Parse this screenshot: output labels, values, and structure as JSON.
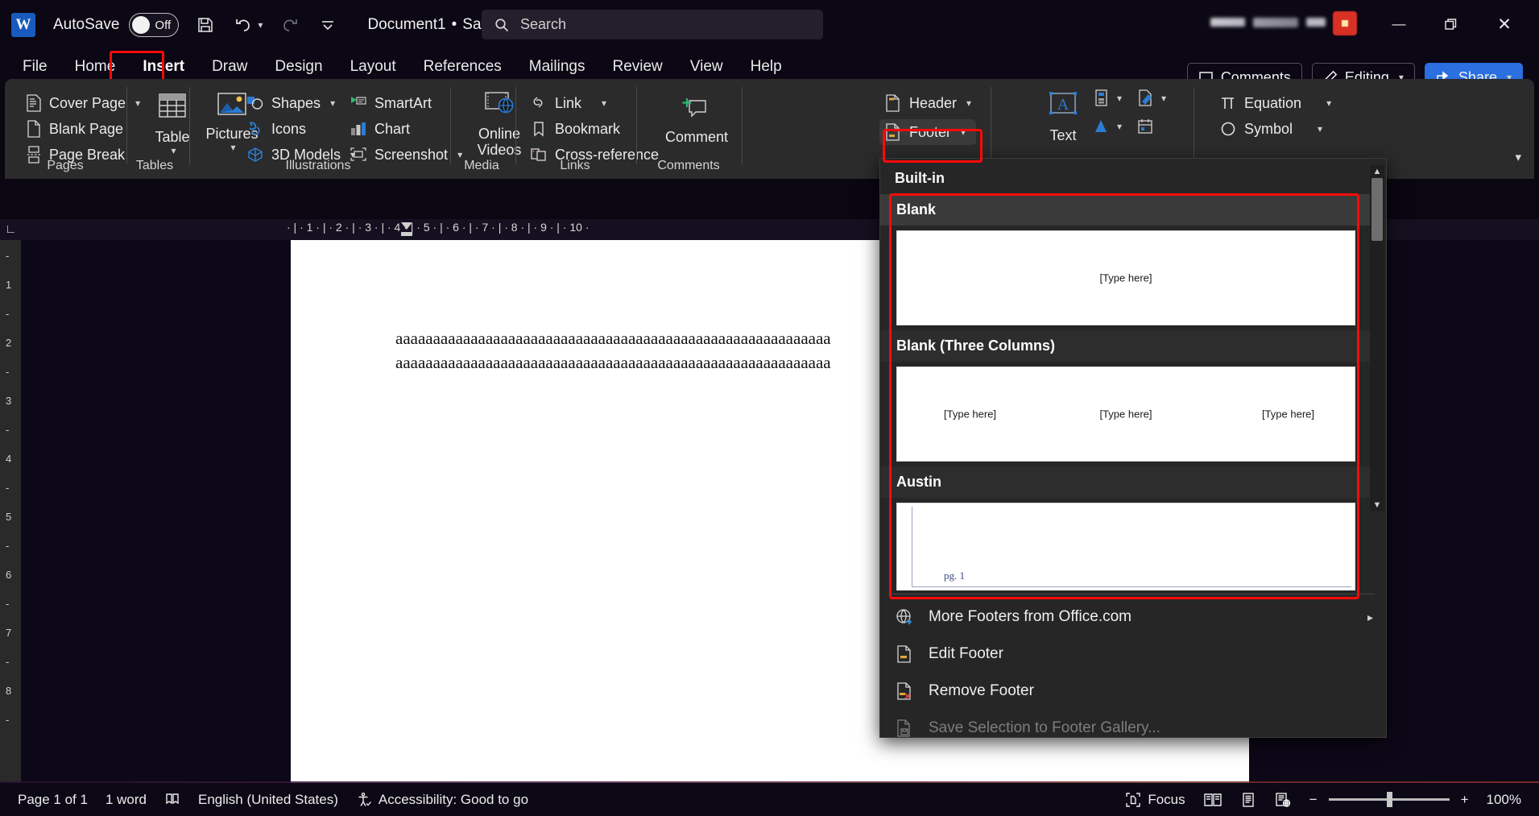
{
  "titlebar": {
    "app_logo": "word-logo",
    "autosave_label": "AutoSave",
    "autosave_state": "Off",
    "save_icon": "save-icon",
    "undo_icon": "undo-icon",
    "redo_icon": "redo-icon",
    "customize_icon": "customize-quick-access-icon",
    "document_title": "Document1",
    "save_state": "Saved",
    "title_chevron": "chevron-down-icon",
    "minimize": "minimize-icon",
    "restore": "restore-icon",
    "close": "close-icon"
  },
  "search": {
    "icon": "search-icon",
    "placeholder": "Search"
  },
  "tabs": [
    {
      "label": "File",
      "active": false
    },
    {
      "label": "Home",
      "active": false
    },
    {
      "label": "Insert",
      "active": true
    },
    {
      "label": "Draw",
      "active": false
    },
    {
      "label": "Design",
      "active": false
    },
    {
      "label": "Layout",
      "active": false
    },
    {
      "label": "References",
      "active": false
    },
    {
      "label": "Mailings",
      "active": false
    },
    {
      "label": "Review",
      "active": false
    },
    {
      "label": "View",
      "active": false
    },
    {
      "label": "Help",
      "active": false
    }
  ],
  "header_buttons": {
    "comments": "Comments",
    "comments_icon": "comment-icon",
    "editing": "Editing",
    "editing_icon": "pencil-icon",
    "editing_chevron": "chevron-down-icon",
    "share": "Share",
    "share_icon": "share-icon",
    "share_chevron": "chevron-down-icon"
  },
  "ribbon": {
    "groups": [
      {
        "name": "Pages",
        "label": "Pages"
      },
      {
        "name": "Tables",
        "label": "Tables"
      },
      {
        "name": "Illustrations",
        "label": "Illustrations"
      },
      {
        "name": "Media",
        "label": "Media"
      },
      {
        "name": "Links",
        "label": "Links"
      },
      {
        "name": "Comments",
        "label": "Comments"
      }
    ],
    "pages": [
      {
        "label": "Cover Page",
        "icon": "cover-page-icon",
        "chevron": true
      },
      {
        "label": "Blank Page",
        "icon": "blank-page-icon",
        "chevron": false
      },
      {
        "label": "Page Break",
        "icon": "page-break-icon",
        "chevron": false
      }
    ],
    "table": {
      "label": "Table",
      "icon": "table-icon",
      "chevron": true
    },
    "pictures": {
      "label": "Pictures",
      "icon": "pictures-icon",
      "chevron": true
    },
    "illustrations": [
      {
        "label": "Shapes",
        "icon": "shapes-icon",
        "chevron": true
      },
      {
        "label": "Icons",
        "icon": "icons-icon",
        "chevron": false
      },
      {
        "label": "3D Models",
        "icon": "3d-models-icon",
        "chevron": true
      },
      {
        "label": "SmartArt",
        "icon": "smartart-icon",
        "chevron": false
      },
      {
        "label": "Chart",
        "icon": "chart-icon",
        "chevron": false
      },
      {
        "label": "Screenshot",
        "icon": "screenshot-icon",
        "chevron": true
      }
    ],
    "online_videos": {
      "label": "Online Videos",
      "icon": "online-videos-icon"
    },
    "links": [
      {
        "label": "Link",
        "icon": "link-icon",
        "chevron": true
      },
      {
        "label": "Bookmark",
        "icon": "bookmark-icon",
        "chevron": false
      },
      {
        "label": "Cross-reference",
        "icon": "cross-reference-icon",
        "chevron": false
      }
    ],
    "comment": {
      "label": "Comment",
      "icon": "new-comment-icon"
    },
    "header": {
      "label": "Header",
      "icon": "header-icon",
      "chevron": true
    },
    "footer": {
      "label": "Footer",
      "icon": "footer-icon",
      "chevron": true
    },
    "text": {
      "label": "Text",
      "icon": "text-box-icon"
    },
    "equation": {
      "label": "Equation",
      "icon": "equation-icon",
      "chevron": true
    },
    "symbol": {
      "label": "Symbol",
      "icon": "symbol-icon",
      "chevron": true
    },
    "collapse": "collapse-ribbon-icon"
  },
  "ruler": {
    "corner": "tab-selector-icon",
    "marks": "·  |  ·  1  ·  |  ·  2  ·  |  ·  3  ·  |  ·  4  ·  |  ·  5  ·  |  ·  6  ·  |  ·  7  ·  |  ·  8  ·  |  ·  9  ·  |  ·  10  ·"
  },
  "vertical_ruler_marks": [
    "-",
    "1",
    "-",
    "2",
    "-",
    "3",
    "-",
    "4",
    "-",
    "5",
    "-",
    "6",
    "-",
    "7",
    "-",
    "8",
    "-"
  ],
  "document": {
    "line1": "aaaaaaaaaaaaaaaaaaaaaaaaaaaaaaaaaaaaaaaaaaaaaaaaaaaaaaaaaa",
    "line2": "aaaaaaaaaaaaaaaaaaaaaaaaaaaaaaaaaaaaaaaaaaaaaaaaaaaaaaaaaa"
  },
  "footer_dropdown": {
    "section_title": "Built-in",
    "gallery": [
      {
        "name": "Blank",
        "placeholders": [
          "[Type here]"
        ],
        "style": "single"
      },
      {
        "name": "Blank (Three Columns)",
        "placeholders": [
          "[Type here]",
          "[Type here]",
          "[Type here]"
        ],
        "style": "three"
      },
      {
        "name": "Austin",
        "placeholders": [
          "pg. 1"
        ],
        "style": "austin"
      }
    ],
    "menu": [
      {
        "label": "More Footers from Office.com",
        "icon": "globe-arrow-icon",
        "accel": "M",
        "disabled": false,
        "submenu": true
      },
      {
        "label": "Edit Footer",
        "icon": "edit-footer-icon",
        "accel": "E",
        "disabled": false,
        "submenu": false
      },
      {
        "label": "Remove Footer",
        "icon": "remove-footer-icon",
        "accel": "R",
        "disabled": false,
        "submenu": false
      },
      {
        "label": "Save Selection to Footer Gallery...",
        "icon": "save-selection-icon",
        "accel": "S",
        "disabled": true,
        "submenu": false
      }
    ],
    "scroll_up": "scroll-up-arrow",
    "scroll_down": "scroll-down-arrow"
  },
  "statusbar": {
    "page": "Page 1 of 1",
    "words": "1 word",
    "proofing_icon": "proofing-icon",
    "language": "English (United States)",
    "accessibility_icon": "accessibility-icon",
    "accessibility": "Accessibility: Good to go",
    "focus": "Focus",
    "focus_icon": "focus-icon",
    "read_mode_icon": "read-mode-icon",
    "print_layout_icon": "print-layout-icon",
    "web_layout_icon": "web-layout-icon",
    "zoom_out": "−",
    "zoom_in": "+",
    "zoom_level": "100%"
  },
  "colors": {
    "accent": "#2b6fe0",
    "highlight": "#fb0a0a",
    "ribbon_bg": "#2b2b2b",
    "titlebar_bg": "#0b0714"
  }
}
